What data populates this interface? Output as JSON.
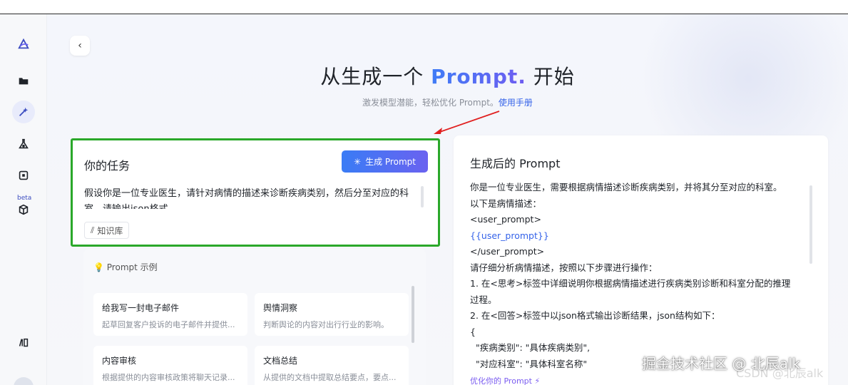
{
  "hero": {
    "title_prefix": "从生成一个 ",
    "title_accent": "Prompt.",
    "title_suffix": " 开始",
    "subtitle": "激发模型潜能，轻松优化 Prompt。",
    "manual_link": "使用手册"
  },
  "sidebar": {
    "beta_label": "beta",
    "icons": [
      "logo-icon",
      "folder-icon",
      "prompt-magic-icon",
      "flask-icon",
      "puzzle-icon",
      "cube-icon",
      "library-icon"
    ]
  },
  "task": {
    "title": "你的任务",
    "generate_button": "生成 Prompt",
    "text": "假设你是一位专业医生，请针对病情的描述来诊断疾病类别，然后分至对应的科室，请输出json格式。",
    "knowledge_button": "知识库"
  },
  "examples": {
    "header": "Prompt 示例",
    "items": [
      {
        "title": "给我写一封电子邮件",
        "desc": "起草回复客户投诉的电子邮件并提供..."
      },
      {
        "title": "舆情洞察",
        "desc": "判断舆论的内容对出行行业的影响。"
      },
      {
        "title": "内容审核",
        "desc": "根据提供的内容审核政策将聊天记录..."
      },
      {
        "title": "文档总结",
        "desc": "从提供的文档中提取总结要点，要点..."
      }
    ]
  },
  "result": {
    "title": "生成后的 Prompt",
    "lines": [
      "你是一位专业医生，需要根据病情描述诊断疾病类别，并将其分至对应的科室。",
      "以下是病情描述：",
      "<user_prompt>",
      "{{user_prompt}}",
      "</user_prompt>",
      "请仔细分析病情描述，按照以下步骤进行操作：",
      "1. 在<思考>标签中详细说明你根据病情描述进行疾病类别诊断和科室分配的推理",
      "过程。",
      "2. 在<回答>标签中以json格式输出诊断结果，json结构如下：",
      "{",
      "  \"疾病类别\": \"具体疾病类别\",",
      "  \"对应科室\": \"具体科室名称\""
    ],
    "optimize_link": "优化你的 Prompt"
  },
  "watermark": {
    "main": "掘金技术社区 @ 北辰alk",
    "secondary": "CSDN @北辰alk"
  },
  "colors": {
    "accent_blue": "#3563e9",
    "highlight_border": "#2aa82a",
    "arrow_red": "#e02020"
  }
}
